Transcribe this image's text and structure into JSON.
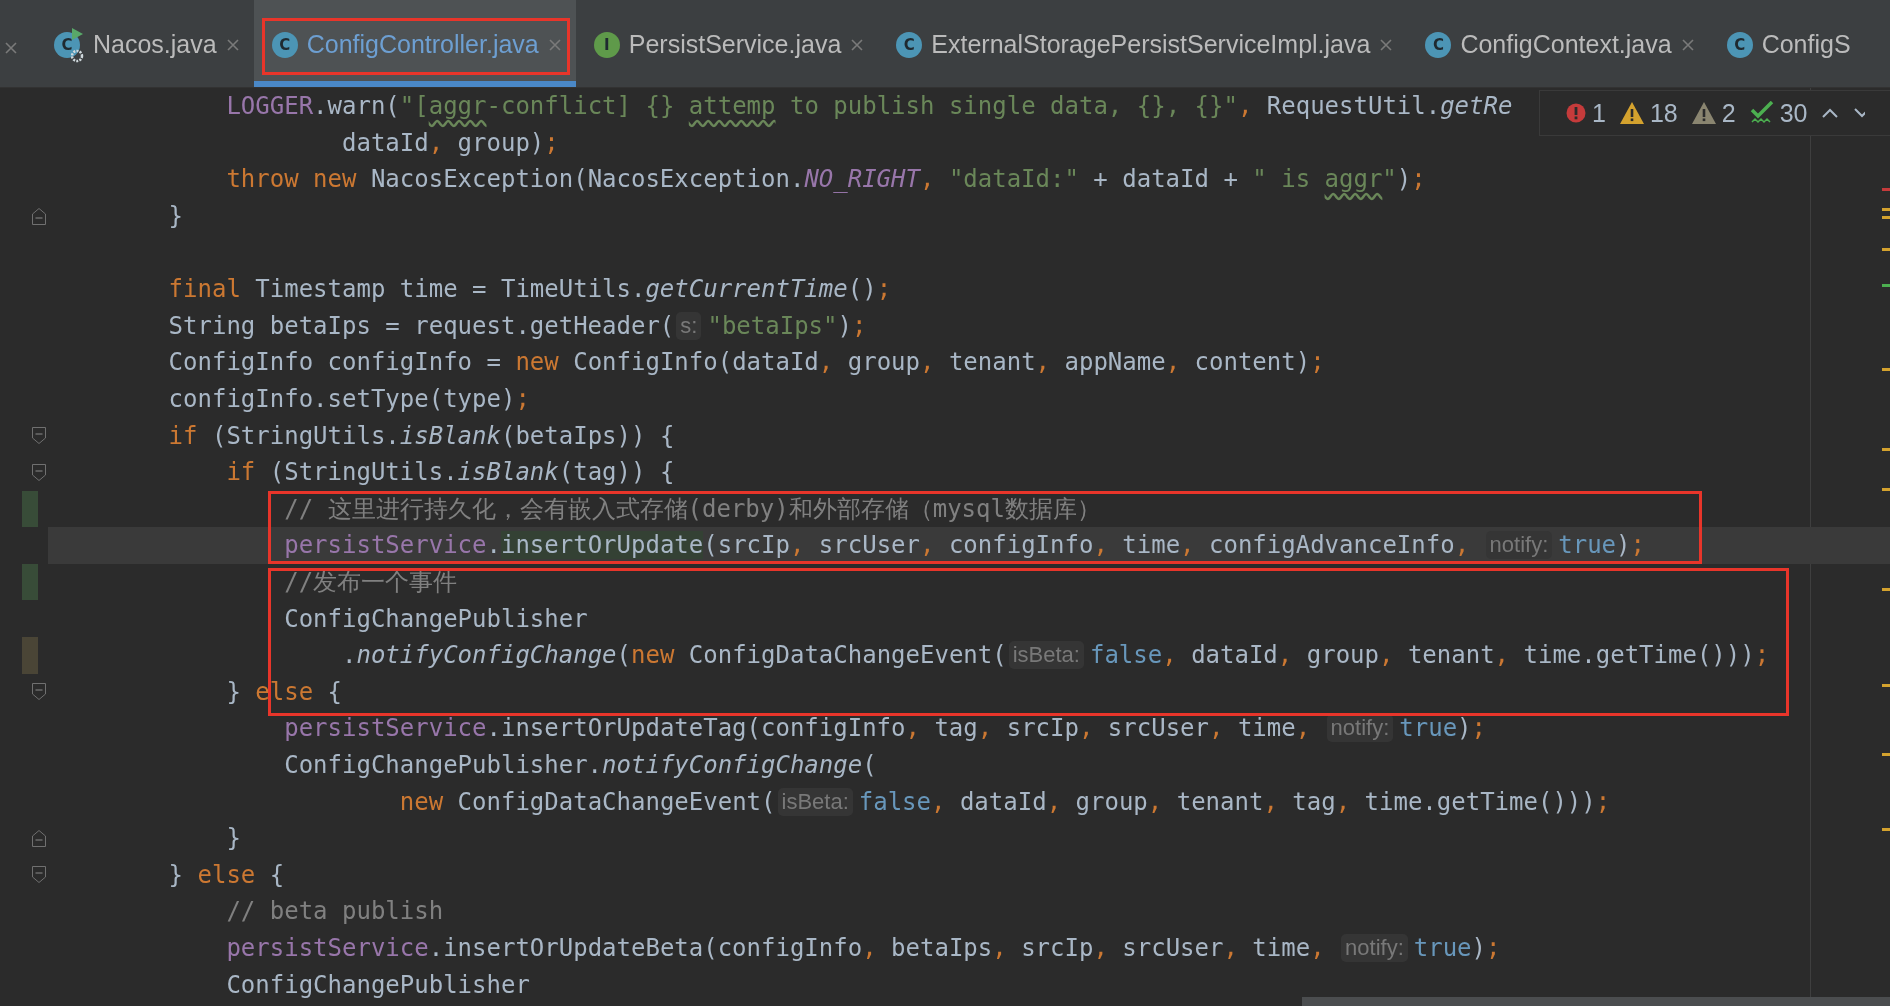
{
  "tabs": [
    {
      "label": "Nacos.java",
      "selected": false,
      "kind": "runnable",
      "icon": "C",
      "closable": true
    },
    {
      "label": "ConfigController.java",
      "selected": true,
      "kind": "class",
      "icon": "C",
      "closable": true
    },
    {
      "label": "PersistService.java",
      "selected": false,
      "kind": "interface",
      "icon": "I",
      "closable": true
    },
    {
      "label": "ExternalStoragePersistServiceImpl.java",
      "selected": false,
      "kind": "class",
      "icon": "C",
      "closable": true
    },
    {
      "label": "ConfigContext.java",
      "selected": false,
      "kind": "class",
      "icon": "C",
      "closable": true
    },
    {
      "label": "ConfigS",
      "selected": false,
      "kind": "class",
      "icon": "C",
      "closable": false
    }
  ],
  "inspections": [
    {
      "kind": "error",
      "count": "1"
    },
    {
      "kind": "warning",
      "count": "18"
    },
    {
      "kind": "weak",
      "count": "2"
    },
    {
      "kind": "typo",
      "count": "30"
    }
  ],
  "code_lines": [
    {
      "kind": "code",
      "tokens": [
        {
          "kind": "field",
          "text": "            LOGGER"
        },
        {
          "kind": "plain",
          "text": ".warn("
        },
        {
          "kind": "string",
          "text": "\"["
        },
        {
          "kind": "typo",
          "text": "aggr"
        },
        {
          "kind": "string",
          "text": "-conflict] {} "
        },
        {
          "kind": "typo",
          "text": "attemp"
        },
        {
          "kind": "string",
          "text": " to publish single data, {}, {}\""
        },
        {
          "kind": "punct",
          "text": ", "
        },
        {
          "kind": "plain",
          "text": "RequestUtil."
        },
        {
          "kind": "static",
          "text": "getRe"
        }
      ]
    },
    {
      "kind": "code",
      "tokens": [
        {
          "kind": "plain",
          "text": "                    dataId"
        },
        {
          "kind": "punct",
          "text": ", "
        },
        {
          "kind": "plain",
          "text": "group)"
        },
        {
          "kind": "punct",
          "text": ";"
        }
      ]
    },
    {
      "kind": "code",
      "tokens": [
        {
          "kind": "keyword",
          "text": "            throw new"
        },
        {
          "kind": "plain",
          "text": " NacosException(NacosException."
        },
        {
          "kind": "constant",
          "text": "NO_RIGHT"
        },
        {
          "kind": "punct",
          "text": ", "
        },
        {
          "kind": "string",
          "text": "\"dataId:\""
        },
        {
          "kind": "plain",
          "text": " + dataId + "
        },
        {
          "kind": "string",
          "text": "\" is "
        },
        {
          "kind": "typo",
          "text": "aggr"
        },
        {
          "kind": "string",
          "text": "\""
        },
        {
          "kind": "plain",
          "text": ")"
        },
        {
          "kind": "punct",
          "text": ";"
        }
      ]
    },
    {
      "kind": "code",
      "fold_end": true,
      "tokens": [
        {
          "kind": "plain",
          "text": "        }"
        }
      ]
    },
    {
      "kind": "blank"
    },
    {
      "kind": "code",
      "tokens": [
        {
          "kind": "keyword",
          "text": "        final"
        },
        {
          "kind": "plain",
          "text": " Timestamp time = TimeUtils."
        },
        {
          "kind": "static",
          "text": "getCurrentTime"
        },
        {
          "kind": "plain",
          "text": "()"
        },
        {
          "kind": "punct",
          "text": ";"
        }
      ]
    },
    {
      "kind": "code",
      "tokens": [
        {
          "kind": "plain",
          "text": "        String betaIps = request.getHeader("
        },
        {
          "kind": "hint",
          "text": "s:"
        },
        {
          "kind": "string",
          "text": "\"betaIps\""
        },
        {
          "kind": "plain",
          "text": ")"
        },
        {
          "kind": "punct",
          "text": ";"
        }
      ]
    },
    {
      "kind": "code",
      "tokens": [
        {
          "kind": "plain",
          "text": "        ConfigInfo configInfo = "
        },
        {
          "kind": "keyword",
          "text": "new"
        },
        {
          "kind": "plain",
          "text": " ConfigInfo(dataId"
        },
        {
          "kind": "punct",
          "text": ", "
        },
        {
          "kind": "plain",
          "text": "group"
        },
        {
          "kind": "punct",
          "text": ", "
        },
        {
          "kind": "plain",
          "text": "tenant"
        },
        {
          "kind": "punct",
          "text": ", "
        },
        {
          "kind": "plain",
          "text": "appName"
        },
        {
          "kind": "punct",
          "text": ", "
        },
        {
          "kind": "plain",
          "text": "content)"
        },
        {
          "kind": "punct",
          "text": ";"
        }
      ]
    },
    {
      "kind": "code",
      "tokens": [
        {
          "kind": "plain",
          "text": "        configInfo.setType(type)"
        },
        {
          "kind": "punct",
          "text": ";"
        }
      ]
    },
    {
      "kind": "code",
      "fold_start": true,
      "tokens": [
        {
          "kind": "keyword",
          "text": "        if"
        },
        {
          "kind": "plain",
          "text": " (StringUtils."
        },
        {
          "kind": "static",
          "text": "isBlank"
        },
        {
          "kind": "plain",
          "text": "(betaIps)) {"
        }
      ]
    },
    {
      "kind": "code",
      "fold_start": true,
      "tokens": [
        {
          "kind": "keyword",
          "text": "            if"
        },
        {
          "kind": "plain",
          "text": " (StringUtils."
        },
        {
          "kind": "static",
          "text": "isBlank"
        },
        {
          "kind": "plain",
          "text": "(tag)) {"
        }
      ]
    },
    {
      "kind": "code",
      "added": true,
      "tokens": [
        {
          "kind": "comment",
          "text": "                // 这里进行持久化，会有嵌入式存储(derby)和外部存储（mysql数据库）"
        }
      ]
    },
    {
      "kind": "code",
      "current": true,
      "tokens": [
        {
          "kind": "field",
          "text": "                persistService"
        },
        {
          "kind": "plain",
          "text": "."
        },
        {
          "kind": "usage",
          "text": "insertOrUpdate"
        },
        {
          "kind": "plain",
          "text": "(srcIp"
        },
        {
          "kind": "punct",
          "text": ", "
        },
        {
          "kind": "plain",
          "text": "srcUser"
        },
        {
          "kind": "punct",
          "text": ", "
        },
        {
          "kind": "plain",
          "text": "configInfo"
        },
        {
          "kind": "punct",
          "text": ", "
        },
        {
          "kind": "plain",
          "text": "time"
        },
        {
          "kind": "punct",
          "text": ", "
        },
        {
          "kind": "plain",
          "text": "configAdvanceInfo"
        },
        {
          "kind": "punct",
          "text": ", "
        },
        {
          "kind": "hint",
          "text": "notify:"
        },
        {
          "kind": "literal",
          "text": "true"
        },
        {
          "kind": "plain",
          "text": ")"
        },
        {
          "kind": "punct",
          "text": ";"
        }
      ]
    },
    {
      "kind": "code",
      "added": true,
      "tokens": [
        {
          "kind": "comment",
          "text": "                //发布一个事件"
        }
      ]
    },
    {
      "kind": "code",
      "tokens": [
        {
          "kind": "plain",
          "text": "                ConfigChangePublisher"
        }
      ]
    },
    {
      "kind": "code",
      "modified": true,
      "tokens": [
        {
          "kind": "plain",
          "text": "                    ."
        },
        {
          "kind": "static",
          "text": "notifyConfigChange"
        },
        {
          "kind": "plain",
          "text": "("
        },
        {
          "kind": "keyword",
          "text": "new"
        },
        {
          "kind": "plain",
          "text": " ConfigDataChangeEvent("
        },
        {
          "kind": "hint",
          "text": "isBeta:"
        },
        {
          "kind": "literal",
          "text": "false"
        },
        {
          "kind": "punct",
          "text": ", "
        },
        {
          "kind": "plain",
          "text": "dataId"
        },
        {
          "kind": "punct",
          "text": ", "
        },
        {
          "kind": "plain",
          "text": "group"
        },
        {
          "kind": "punct",
          "text": ", "
        },
        {
          "kind": "plain",
          "text": "tenant"
        },
        {
          "kind": "punct",
          "text": ", "
        },
        {
          "kind": "plain",
          "text": "time.getTime()))"
        },
        {
          "kind": "punct",
          "text": ";"
        }
      ]
    },
    {
      "kind": "code",
      "fold_start": true,
      "tokens": [
        {
          "kind": "plain",
          "text": "            } "
        },
        {
          "kind": "keyword",
          "text": "else"
        },
        {
          "kind": "plain",
          "text": " {"
        }
      ]
    },
    {
      "kind": "code",
      "tokens": [
        {
          "kind": "field",
          "text": "                persistService"
        },
        {
          "kind": "plain",
          "text": ".insertOrUpdateTag(configInfo"
        },
        {
          "kind": "punct",
          "text": ", "
        },
        {
          "kind": "plain",
          "text": "tag"
        },
        {
          "kind": "punct",
          "text": ", "
        },
        {
          "kind": "plain",
          "text": "srcIp"
        },
        {
          "kind": "punct",
          "text": ", "
        },
        {
          "kind": "plain",
          "text": "srcUser"
        },
        {
          "kind": "punct",
          "text": ", "
        },
        {
          "kind": "plain",
          "text": "time"
        },
        {
          "kind": "punct",
          "text": ", "
        },
        {
          "kind": "hint",
          "text": "notify:"
        },
        {
          "kind": "literal",
          "text": "true"
        },
        {
          "kind": "plain",
          "text": ")"
        },
        {
          "kind": "punct",
          "text": ";"
        }
      ]
    },
    {
      "kind": "code",
      "tokens": [
        {
          "kind": "plain",
          "text": "                ConfigChangePublisher."
        },
        {
          "kind": "static",
          "text": "notifyConfigChange"
        },
        {
          "kind": "plain",
          "text": "("
        }
      ]
    },
    {
      "kind": "code",
      "tokens": [
        {
          "kind": "keyword",
          "text": "                        new"
        },
        {
          "kind": "plain",
          "text": " ConfigDataChangeEvent("
        },
        {
          "kind": "hint",
          "text": "isBeta:"
        },
        {
          "kind": "literal",
          "text": "false"
        },
        {
          "kind": "punct",
          "text": ", "
        },
        {
          "kind": "plain",
          "text": "dataId"
        },
        {
          "kind": "punct",
          "text": ", "
        },
        {
          "kind": "plain",
          "text": "group"
        },
        {
          "kind": "punct",
          "text": ", "
        },
        {
          "kind": "plain",
          "text": "tenant"
        },
        {
          "kind": "punct",
          "text": ", "
        },
        {
          "kind": "plain",
          "text": "tag"
        },
        {
          "kind": "punct",
          "text": ", "
        },
        {
          "kind": "plain",
          "text": "time.getTime()))"
        },
        {
          "kind": "punct",
          "text": ";"
        }
      ]
    },
    {
      "kind": "code",
      "fold_end": true,
      "tokens": [
        {
          "kind": "plain",
          "text": "            }"
        }
      ]
    },
    {
      "kind": "code",
      "fold_start": true,
      "tokens": [
        {
          "kind": "plain",
          "text": "        } "
        },
        {
          "kind": "keyword",
          "text": "else"
        },
        {
          "kind": "plain",
          "text": " {"
        }
      ]
    },
    {
      "kind": "code",
      "tokens": [
        {
          "kind": "comment",
          "text": "            // beta publish"
        }
      ]
    },
    {
      "kind": "code",
      "tokens": [
        {
          "kind": "field",
          "text": "            persistService"
        },
        {
          "kind": "plain",
          "text": ".insertOrUpdateBeta(configInfo"
        },
        {
          "kind": "punct",
          "text": ", "
        },
        {
          "kind": "plain",
          "text": "betaIps"
        },
        {
          "kind": "punct",
          "text": ", "
        },
        {
          "kind": "plain",
          "text": "srcIp"
        },
        {
          "kind": "punct",
          "text": ", "
        },
        {
          "kind": "plain",
          "text": "srcUser"
        },
        {
          "kind": "punct",
          "text": ", "
        },
        {
          "kind": "plain",
          "text": "time"
        },
        {
          "kind": "punct",
          "text": ", "
        },
        {
          "kind": "hint",
          "text": "notify:"
        },
        {
          "kind": "literal",
          "text": "true"
        },
        {
          "kind": "plain",
          "text": ")"
        },
        {
          "kind": "punct",
          "text": ";"
        }
      ]
    },
    {
      "kind": "code",
      "tokens": [
        {
          "kind": "plain",
          "text": "            ConfigChangePublisher"
        }
      ]
    }
  ]
}
